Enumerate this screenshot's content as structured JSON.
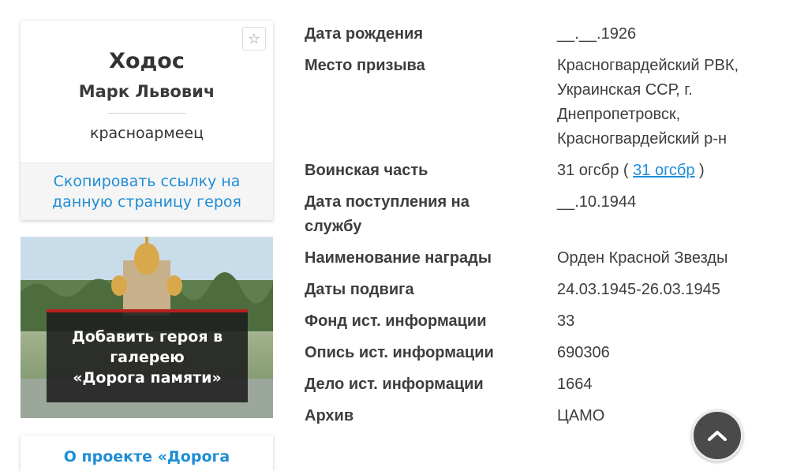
{
  "hero": {
    "surname": "Ходос",
    "name": "Марк Львович",
    "rank": "красноармеец",
    "copy_link_line1": "Скопировать ссылку на",
    "copy_link_line2": "данную страницу героя"
  },
  "banner": {
    "line1": "Добавить героя в",
    "line2": "галерею",
    "line3": "«Дорога памяти»"
  },
  "about": {
    "label": "О проекте «Дорога"
  },
  "info": {
    "rows": [
      {
        "label": "Дата рождения",
        "value": "__.__.1926"
      },
      {
        "label": "Место призыва",
        "value_lines": [
          "Красногвардейский РВК,",
          "Украинская ССР, г.",
          "Днепропетровск,",
          "Красногвардейский р-н"
        ]
      },
      {
        "label": "Воинская часть",
        "value_prefix": "31 огсбр ( ",
        "value_link": "31 огсбр",
        "value_suffix": " )"
      },
      {
        "label_lines": [
          "Дата поступления на",
          "службу"
        ],
        "value": "__.10.1944"
      },
      {
        "label": "Наименование награды",
        "value": "Орден Красной Звезды"
      },
      {
        "label": "Даты подвига",
        "value": "24.03.1945-26.03.1945"
      },
      {
        "label": "Фонд ист. информации",
        "value": "33"
      },
      {
        "label": "Опись ист. информации",
        "value": "690306"
      },
      {
        "label": "Дело ист. информации",
        "value": "1664"
      },
      {
        "label": "Архив",
        "value": "ЦАМО"
      }
    ]
  },
  "icons": {
    "favorite": "star-outline-icon",
    "scroll_top": "chevron-up-icon"
  },
  "colors": {
    "link": "#1f8dd6",
    "banner_accent": "#b81f1f",
    "scroll_button": "#4a4a4a"
  }
}
